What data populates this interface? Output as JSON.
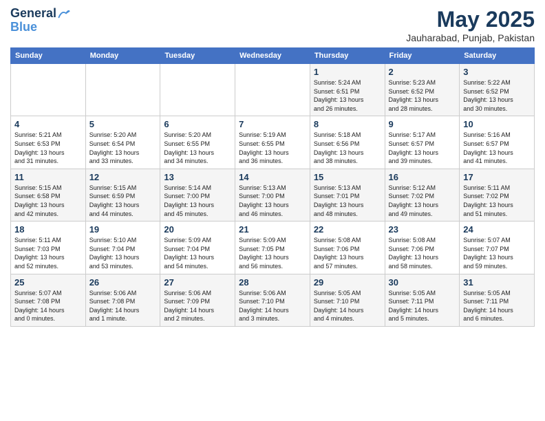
{
  "header": {
    "logo_line1": "General",
    "logo_line2": "Blue",
    "title": "May 2025",
    "subtitle": "Jauharabad, Punjab, Pakistan"
  },
  "days_of_week": [
    "Sunday",
    "Monday",
    "Tuesday",
    "Wednesday",
    "Thursday",
    "Friday",
    "Saturday"
  ],
  "weeks": [
    [
      {
        "num": "",
        "info": ""
      },
      {
        "num": "",
        "info": ""
      },
      {
        "num": "",
        "info": ""
      },
      {
        "num": "",
        "info": ""
      },
      {
        "num": "1",
        "info": "Sunrise: 5:24 AM\nSunset: 6:51 PM\nDaylight: 13 hours\nand 26 minutes."
      },
      {
        "num": "2",
        "info": "Sunrise: 5:23 AM\nSunset: 6:52 PM\nDaylight: 13 hours\nand 28 minutes."
      },
      {
        "num": "3",
        "info": "Sunrise: 5:22 AM\nSunset: 6:52 PM\nDaylight: 13 hours\nand 30 minutes."
      }
    ],
    [
      {
        "num": "4",
        "info": "Sunrise: 5:21 AM\nSunset: 6:53 PM\nDaylight: 13 hours\nand 31 minutes."
      },
      {
        "num": "5",
        "info": "Sunrise: 5:20 AM\nSunset: 6:54 PM\nDaylight: 13 hours\nand 33 minutes."
      },
      {
        "num": "6",
        "info": "Sunrise: 5:20 AM\nSunset: 6:55 PM\nDaylight: 13 hours\nand 34 minutes."
      },
      {
        "num": "7",
        "info": "Sunrise: 5:19 AM\nSunset: 6:55 PM\nDaylight: 13 hours\nand 36 minutes."
      },
      {
        "num": "8",
        "info": "Sunrise: 5:18 AM\nSunset: 6:56 PM\nDaylight: 13 hours\nand 38 minutes."
      },
      {
        "num": "9",
        "info": "Sunrise: 5:17 AM\nSunset: 6:57 PM\nDaylight: 13 hours\nand 39 minutes."
      },
      {
        "num": "10",
        "info": "Sunrise: 5:16 AM\nSunset: 6:57 PM\nDaylight: 13 hours\nand 41 minutes."
      }
    ],
    [
      {
        "num": "11",
        "info": "Sunrise: 5:15 AM\nSunset: 6:58 PM\nDaylight: 13 hours\nand 42 minutes."
      },
      {
        "num": "12",
        "info": "Sunrise: 5:15 AM\nSunset: 6:59 PM\nDaylight: 13 hours\nand 44 minutes."
      },
      {
        "num": "13",
        "info": "Sunrise: 5:14 AM\nSunset: 7:00 PM\nDaylight: 13 hours\nand 45 minutes."
      },
      {
        "num": "14",
        "info": "Sunrise: 5:13 AM\nSunset: 7:00 PM\nDaylight: 13 hours\nand 46 minutes."
      },
      {
        "num": "15",
        "info": "Sunrise: 5:13 AM\nSunset: 7:01 PM\nDaylight: 13 hours\nand 48 minutes."
      },
      {
        "num": "16",
        "info": "Sunrise: 5:12 AM\nSunset: 7:02 PM\nDaylight: 13 hours\nand 49 minutes."
      },
      {
        "num": "17",
        "info": "Sunrise: 5:11 AM\nSunset: 7:02 PM\nDaylight: 13 hours\nand 51 minutes."
      }
    ],
    [
      {
        "num": "18",
        "info": "Sunrise: 5:11 AM\nSunset: 7:03 PM\nDaylight: 13 hours\nand 52 minutes."
      },
      {
        "num": "19",
        "info": "Sunrise: 5:10 AM\nSunset: 7:04 PM\nDaylight: 13 hours\nand 53 minutes."
      },
      {
        "num": "20",
        "info": "Sunrise: 5:09 AM\nSunset: 7:04 PM\nDaylight: 13 hours\nand 54 minutes."
      },
      {
        "num": "21",
        "info": "Sunrise: 5:09 AM\nSunset: 7:05 PM\nDaylight: 13 hours\nand 56 minutes."
      },
      {
        "num": "22",
        "info": "Sunrise: 5:08 AM\nSunset: 7:06 PM\nDaylight: 13 hours\nand 57 minutes."
      },
      {
        "num": "23",
        "info": "Sunrise: 5:08 AM\nSunset: 7:06 PM\nDaylight: 13 hours\nand 58 minutes."
      },
      {
        "num": "24",
        "info": "Sunrise: 5:07 AM\nSunset: 7:07 PM\nDaylight: 13 hours\nand 59 minutes."
      }
    ],
    [
      {
        "num": "25",
        "info": "Sunrise: 5:07 AM\nSunset: 7:08 PM\nDaylight: 14 hours\nand 0 minutes."
      },
      {
        "num": "26",
        "info": "Sunrise: 5:06 AM\nSunset: 7:08 PM\nDaylight: 14 hours\nand 1 minute."
      },
      {
        "num": "27",
        "info": "Sunrise: 5:06 AM\nSunset: 7:09 PM\nDaylight: 14 hours\nand 2 minutes."
      },
      {
        "num": "28",
        "info": "Sunrise: 5:06 AM\nSunset: 7:10 PM\nDaylight: 14 hours\nand 3 minutes."
      },
      {
        "num": "29",
        "info": "Sunrise: 5:05 AM\nSunset: 7:10 PM\nDaylight: 14 hours\nand 4 minutes."
      },
      {
        "num": "30",
        "info": "Sunrise: 5:05 AM\nSunset: 7:11 PM\nDaylight: 14 hours\nand 5 minutes."
      },
      {
        "num": "31",
        "info": "Sunrise: 5:05 AM\nSunset: 7:11 PM\nDaylight: 14 hours\nand 6 minutes."
      }
    ]
  ]
}
